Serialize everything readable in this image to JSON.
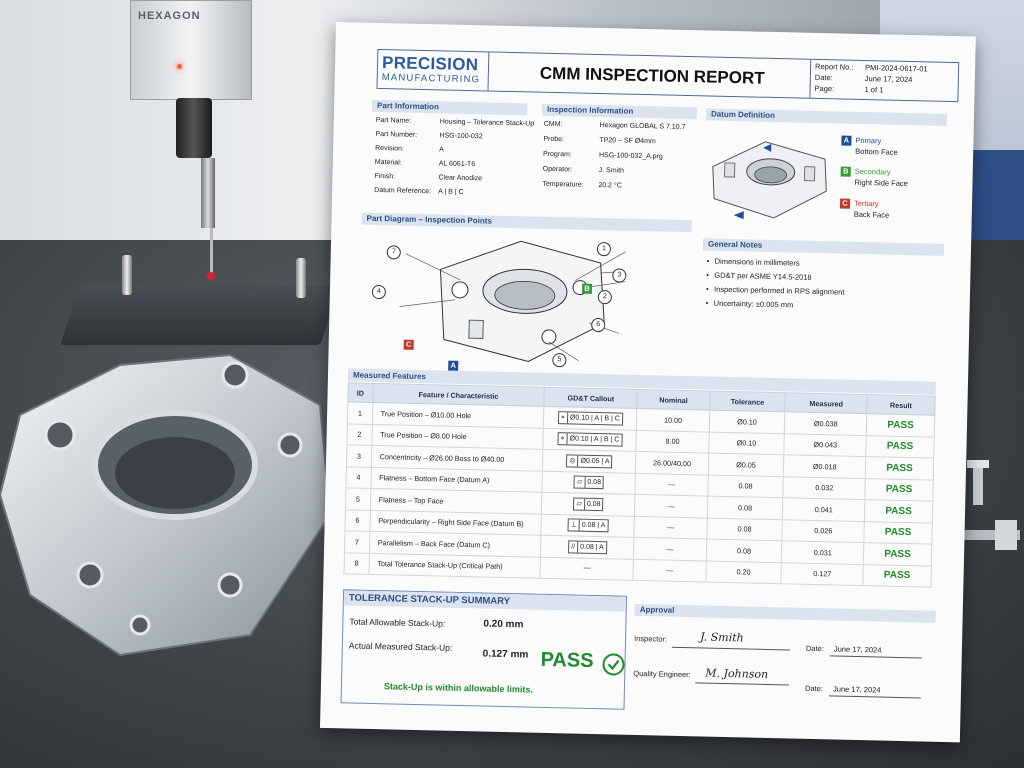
{
  "scene": {
    "machine_brand": "HEXAGON"
  },
  "report": {
    "logo_line1": "PRECISION",
    "logo_line2": "MANUFACTURING",
    "title": "CMM INSPECTION REPORT",
    "meta": [
      {
        "label": "Report No.:",
        "value": "PMI-2024-0617-01"
      },
      {
        "label": "Date:",
        "value": "June 17, 2024"
      },
      {
        "label": "Page:",
        "value": "1 of 1"
      }
    ],
    "part_info": {
      "heading": "Part Information",
      "rows": [
        {
          "label": "Part Name:",
          "value": "Housing – Tolerance Stack-Up"
        },
        {
          "label": "Part Number:",
          "value": "HSG-100-032"
        },
        {
          "label": "Revision:",
          "value": "A"
        },
        {
          "label": "Material:",
          "value": "AL 6061-T6"
        },
        {
          "label": "Finish:",
          "value": "Clear Anodize"
        },
        {
          "label": "Datum Reference:",
          "value": "A | B | C"
        }
      ]
    },
    "inspection_info": {
      "heading": "Inspection Information",
      "rows": [
        {
          "label": "CMM:",
          "value": "Hexagon GLOBAL S 7.10.7"
        },
        {
          "label": "Probe:",
          "value": "TP20 – SF Ø4mm"
        },
        {
          "label": "Program:",
          "value": "HSG-100-032_A.prg"
        },
        {
          "label": "Operator:",
          "value": "J. Smith"
        },
        {
          "label": "Temperature:",
          "value": "20.2 °C"
        }
      ]
    },
    "datum_definition": {
      "heading": "Datum Definition",
      "datums": [
        {
          "letter": "A",
          "name": "Primary",
          "face": "Bottom Face",
          "color": "#1f4d9a"
        },
        {
          "letter": "B",
          "name": "Secondary",
          "face": "Right Side Face",
          "color": "#3a9a3a"
        },
        {
          "letter": "C",
          "name": "Tertiary",
          "face": "Back Face",
          "color": "#c0392b"
        }
      ]
    },
    "diagram": {
      "heading": "Part Diagram – Inspection Points",
      "callouts": [
        "1",
        "2",
        "3",
        "4",
        "5",
        "6",
        "7"
      ],
      "datum_tags": [
        "A",
        "B",
        "C"
      ]
    },
    "notes": {
      "heading": "General Notes",
      "items": [
        "Dimensions in millimeters",
        "GD&T per ASME Y14.5-2018",
        "Inspection performed in RPS alignment",
        "Uncertainty: ±0.005 mm"
      ]
    },
    "measured": {
      "heading": "Measured Features",
      "columns": [
        "ID",
        "Feature / Characteristic",
        "GD&T Callout",
        "Nominal",
        "Tolerance",
        "Measured",
        "Result"
      ],
      "rows": [
        {
          "id": "1",
          "feature": "True Position – Ø10.00 Hole",
          "sym": "⌖",
          "callout": "Ø0.10 | A | B | C",
          "nominal": "10.00",
          "tolerance": "Ø0.10",
          "measured": "Ø0.038",
          "result": "PASS"
        },
        {
          "id": "2",
          "feature": "True Position – Ø8.00 Hole",
          "sym": "⌖",
          "callout": "Ø0.10 | A | B | C",
          "nominal": "8.00",
          "tolerance": "Ø0.10",
          "measured": "Ø0.043",
          "result": "PASS"
        },
        {
          "id": "3",
          "feature": "Concentricity – Ø26.00 Boss to Ø40.00",
          "sym": "◎",
          "callout": "Ø0.05 | A",
          "nominal": "26.00/40.00",
          "tolerance": "Ø0.05",
          "measured": "Ø0.018",
          "result": "PASS"
        },
        {
          "id": "4",
          "feature": "Flatness – Bottom Face (Datum A)",
          "sym": "▱",
          "callout": "0.08",
          "nominal": "—",
          "tolerance": "0.08",
          "measured": "0.032",
          "result": "PASS"
        },
        {
          "id": "5",
          "feature": "Flatness – Top Face",
          "sym": "▱",
          "callout": "0.08",
          "nominal": "—",
          "tolerance": "0.08",
          "measured": "0.041",
          "result": "PASS"
        },
        {
          "id": "6",
          "feature": "Perpendicularity – Right Side Face (Datum B)",
          "sym": "⊥",
          "callout": "0.08 | A",
          "nominal": "—",
          "tolerance": "0.08",
          "measured": "0.026",
          "result": "PASS"
        },
        {
          "id": "7",
          "feature": "Parallelism – Back Face (Datum C)",
          "sym": "//",
          "callout": "0.08 | A",
          "nominal": "—",
          "tolerance": "0.08",
          "measured": "0.031",
          "result": "PASS"
        },
        {
          "id": "8",
          "feature": "Total Tolerance Stack-Up (Critical Path)",
          "sym": "",
          "callout": "—",
          "nominal": "—",
          "tolerance": "0.20",
          "measured": "0.127",
          "result": "PASS"
        }
      ]
    },
    "summary": {
      "heading": "TOLERANCE STACK-UP SUMMARY",
      "allow_label": "Total Allowable Stack-Up:",
      "allow_value": "0.20 mm",
      "actual_label": "Actual Measured Stack-Up:",
      "actual_value": "0.127 mm",
      "result": "PASS",
      "message": "Stack-Up is within allowable limits.",
      "pass_color": "#1f8a2e"
    },
    "approval": {
      "heading": "Approval",
      "inspector_label": "Inspector:",
      "inspector_sig": "J. Smith",
      "inspector_date_label": "Date:",
      "inspector_date": "June 17, 2024",
      "qe_label": "Quality Engineer:",
      "qe_sig": "M. Johnson",
      "qe_date_label": "Date:",
      "qe_date": "June 17, 2024"
    }
  }
}
